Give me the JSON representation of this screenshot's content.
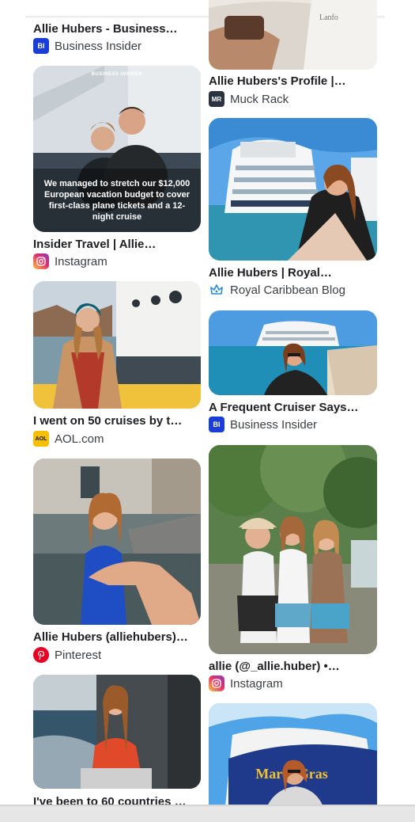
{
  "left_column": [
    {
      "title": "Allie Hubers - Business…",
      "source": "Business Insider",
      "favicon": "business-insider-icon",
      "favicon_text": "BI",
      "favicon_color": "#1a3dd6"
    },
    {
      "title": "Insider Travel | Allie…",
      "source": "Instagram",
      "favicon": "instagram-icon",
      "overlay_brand": "BUSINESS INSIDER",
      "overlay_text": "We managed to stretch our $12,000 European vacation budget to cover first-class plane tickets and a 12-night cruise"
    },
    {
      "title": "I went on 50 cruises by t…",
      "source": "AOL.com",
      "favicon": "aol-icon",
      "favicon_text": "AOL",
      "favicon_color": "#f6c000"
    },
    {
      "title": "Allie Hubers (alliehubers)…",
      "source": "Pinterest",
      "favicon": "pinterest-icon",
      "favicon_color": "#e60023"
    },
    {
      "title": "I've been to 60 countries …",
      "source": "",
      "favicon": ""
    }
  ],
  "right_column": [
    {
      "title": "Allie Hubers's Profile |…",
      "source": "Muck Rack",
      "favicon": "muck-rack-icon",
      "favicon_text": "MR",
      "favicon_color": "#2b3340"
    },
    {
      "title": "Allie Hubers | Royal…",
      "source": "Royal Caribbean Blog",
      "favicon": "royal-caribbean-crown-icon",
      "favicon_color": "#2a8ad6"
    },
    {
      "title": "A Frequent Cruiser Says…",
      "source": "Business Insider",
      "favicon": "business-insider-icon",
      "favicon_text": "BI",
      "favicon_color": "#1a3dd6"
    },
    {
      "title": "allie (@_allie.huber) •…",
      "source": "Instagram",
      "favicon": "instagram-icon"
    },
    {
      "title": "",
      "source": "",
      "favicon": "",
      "ship_text": "Mardi Gras"
    }
  ]
}
